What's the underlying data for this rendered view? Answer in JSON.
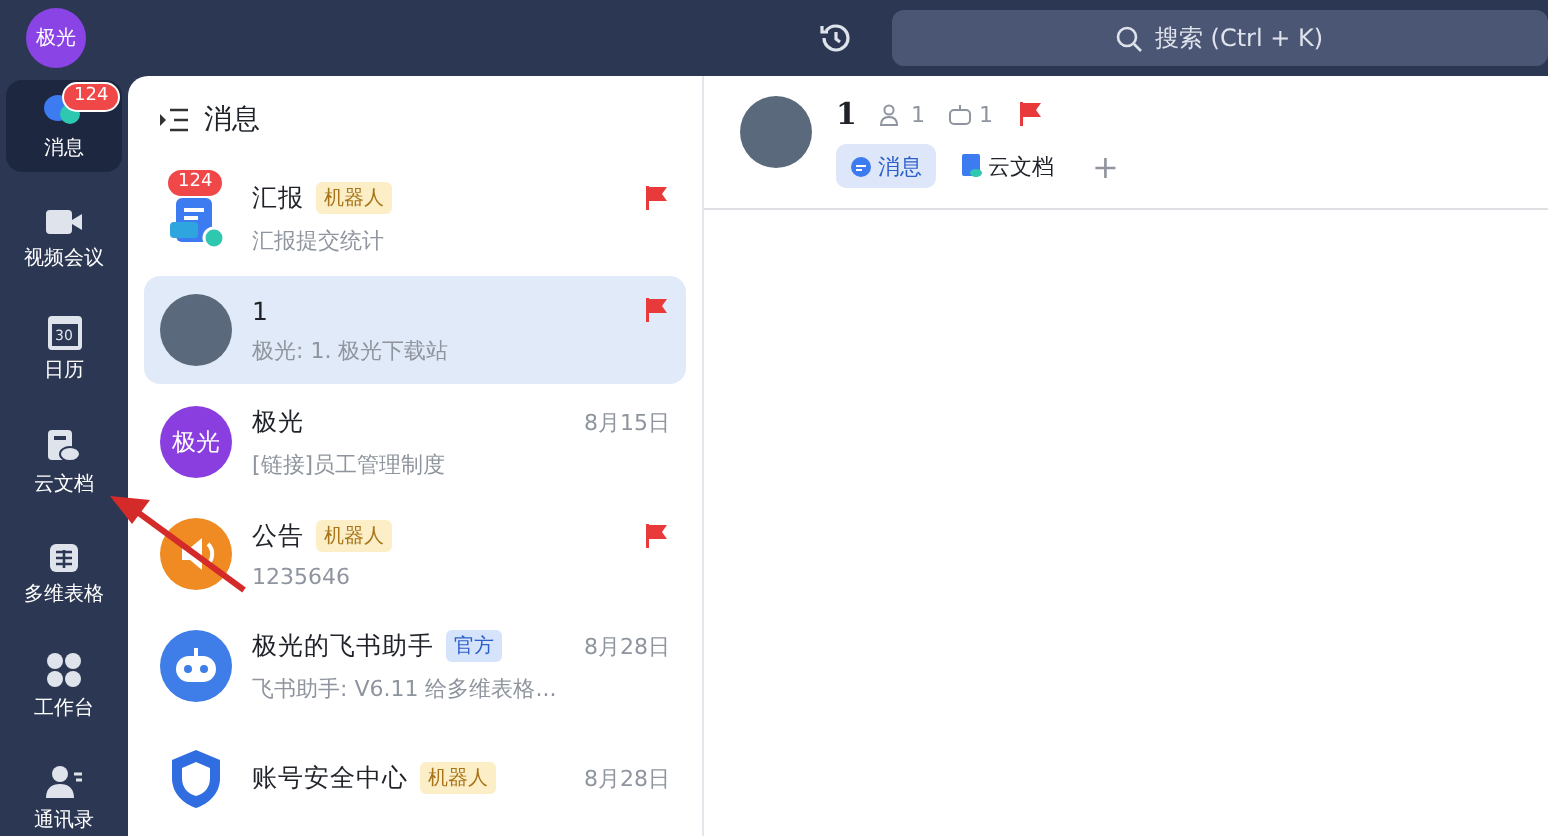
{
  "profile": {
    "avatar_text": "极光"
  },
  "search": {
    "placeholder": "搜索 (Ctrl + K)"
  },
  "sidebar": {
    "items": [
      {
        "label": "消息",
        "selected": true,
        "badge": "124"
      },
      {
        "label": "视频会议",
        "selected": false
      },
      {
        "label": "日历",
        "selected": false,
        "icon_text": "30"
      },
      {
        "label": "云文档",
        "selected": false
      },
      {
        "label": "多维表格",
        "selected": false
      },
      {
        "label": "工作台",
        "selected": false
      },
      {
        "label": "通讯录",
        "selected": false
      }
    ]
  },
  "message_list": {
    "title": "消息",
    "items": [
      {
        "name": "汇报",
        "tag": {
          "kind": "robot",
          "text": "机器人"
        },
        "preview": "汇报提交统计",
        "badge": "124",
        "flagged": true,
        "selected": false
      },
      {
        "name": "1",
        "preview": "极光: 1. 极光下载站",
        "flagged": true,
        "selected": true
      },
      {
        "name": "极光",
        "avatar_text": "极光",
        "preview": "[链接]员工管理制度",
        "date": "8月15日",
        "flagged": false,
        "selected": false
      },
      {
        "name": "公告",
        "tag": {
          "kind": "robot",
          "text": "机器人"
        },
        "preview": "1235646",
        "flagged": true,
        "selected": false
      },
      {
        "name": "极光的飞书助手",
        "tag": {
          "kind": "official",
          "text": "官方"
        },
        "preview": "飞书助手: V6.11 给多维表格...",
        "date": "8月28日",
        "flagged": false,
        "selected": false
      },
      {
        "name": "账号安全中心",
        "tag": {
          "kind": "robot",
          "text": "机器人"
        },
        "date": "8月28日",
        "flagged": false,
        "selected": false
      }
    ]
  },
  "chat": {
    "title": "1",
    "members": "1",
    "bots": "1",
    "flagged": true,
    "tabs": [
      {
        "label": "消息",
        "selected": true
      },
      {
        "label": "云文档",
        "selected": false
      }
    ],
    "add_tab": "+"
  }
}
